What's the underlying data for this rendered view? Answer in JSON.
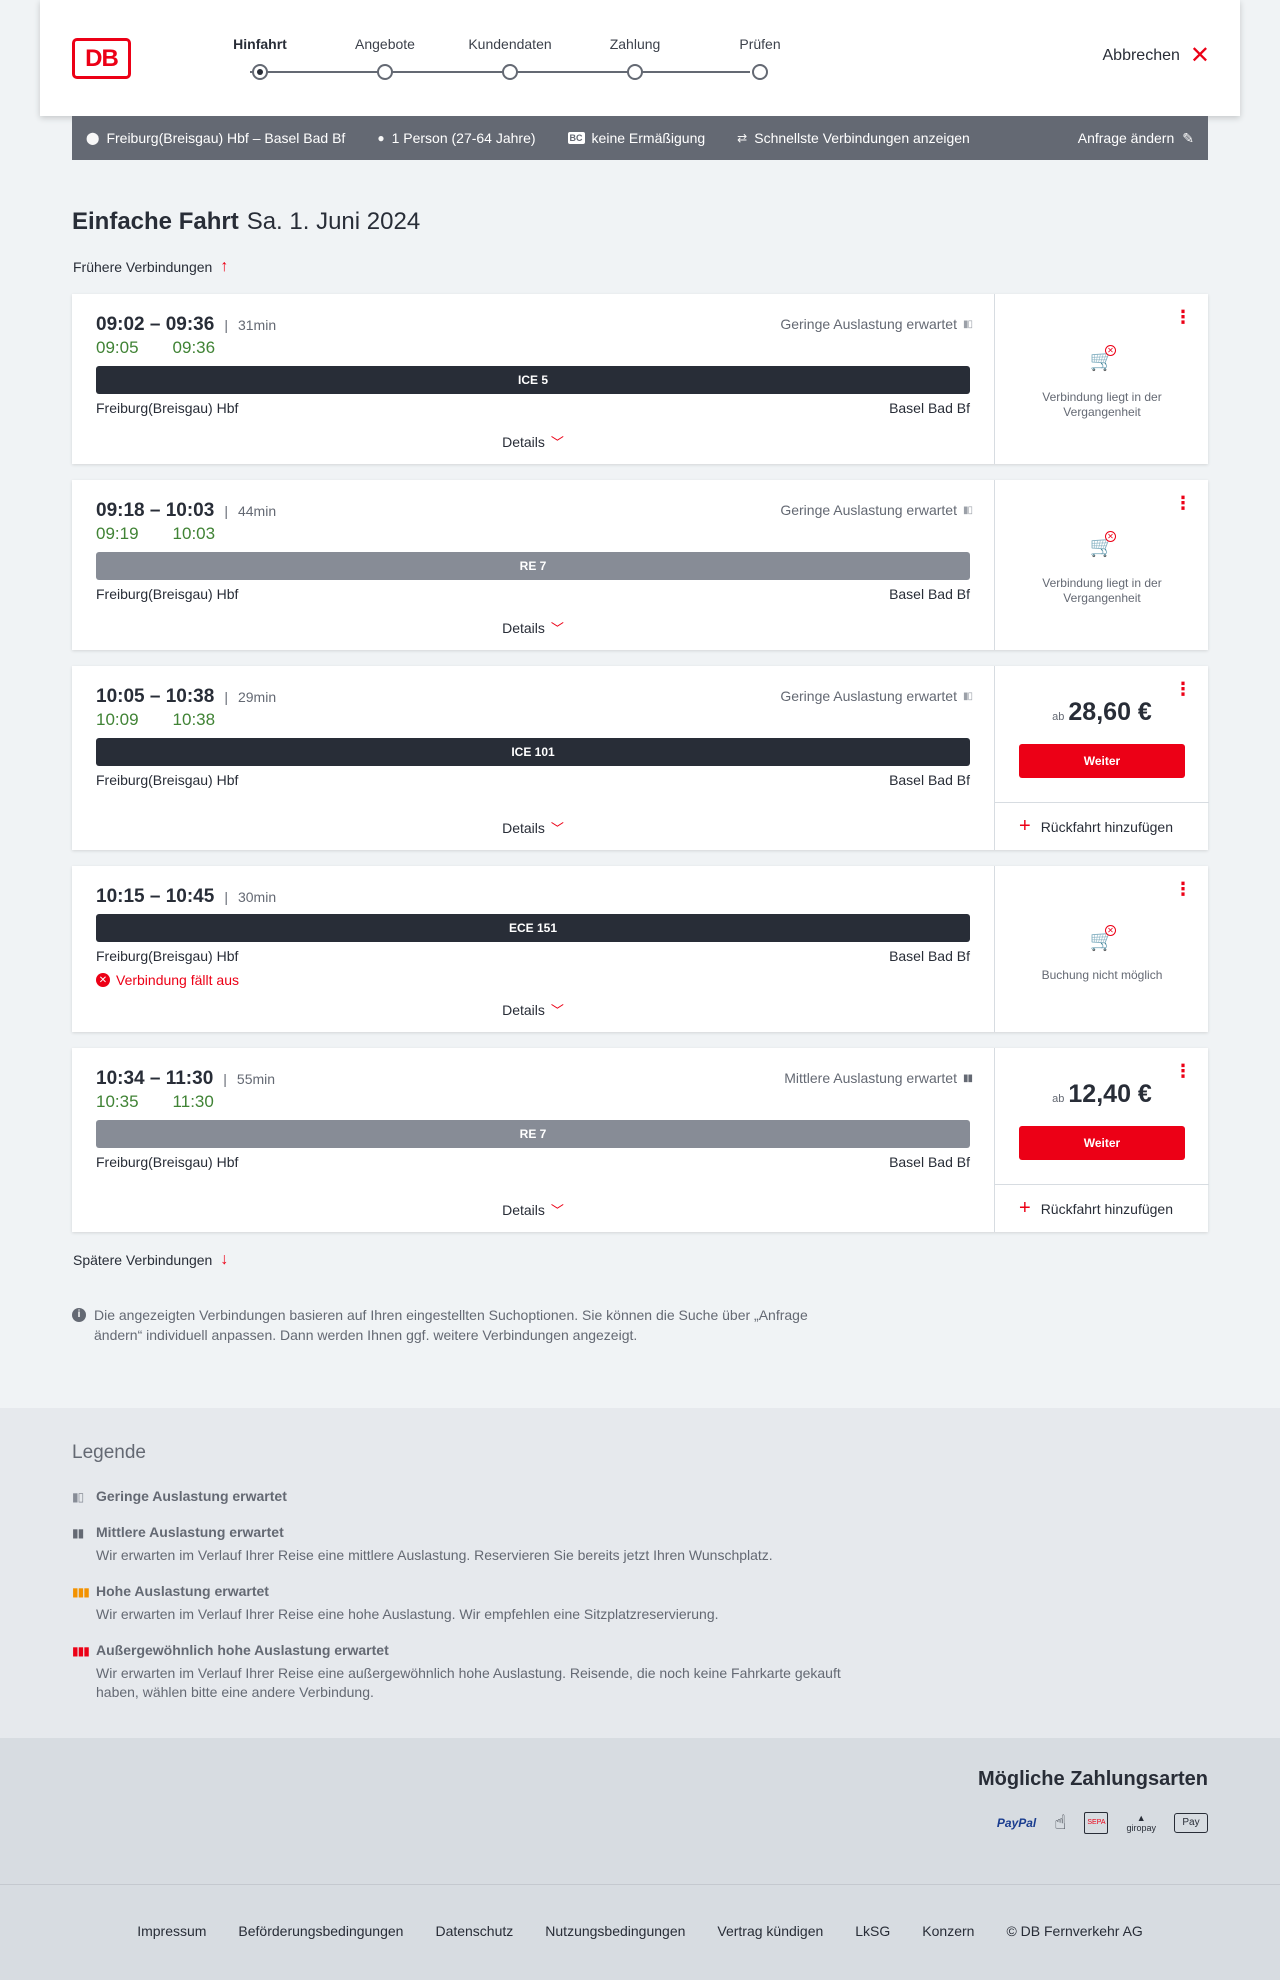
{
  "header": {
    "logo": "DB",
    "steps": [
      {
        "label": "Hinfahrt",
        "active": true
      },
      {
        "label": "Angebote",
        "active": false
      },
      {
        "label": "Kundendaten",
        "active": false
      },
      {
        "label": "Zahlung",
        "active": false
      },
      {
        "label": "Prüfen",
        "active": false
      }
    ],
    "cancel_label": "Abbrechen"
  },
  "search": {
    "route": "Freiburg(Breisgau) Hbf – Basel Bad Bf",
    "persons": "1 Person (27-64 Jahre)",
    "discount": "keine Ermäßigung",
    "discount_badge": "BC",
    "fastest": "Schnellste Verbindungen anzeigen",
    "edit": "Anfrage ändern"
  },
  "title": {
    "main": "Einfache Fahrt",
    "date": "Sa. 1. Juni 2024"
  },
  "earlier": "Frühere Verbindungen",
  "later": "Spätere Verbindungen",
  "common": {
    "details": "Details",
    "from": "Freiburg(Breisgau) Hbf",
    "to": "Basel Bad Bf",
    "weiter": "Weiter",
    "return": "Rückfahrt hinzufügen",
    "ab": "ab"
  },
  "connections": [
    {
      "times": "09:02 – 09:36",
      "duration": "31min",
      "rt_dep": "09:05",
      "rt_arr": "09:36",
      "load": "Geringe Auslastung erwartet",
      "train": "ICE 5",
      "status_text": "Verbindung liegt in der Vergangenheit"
    },
    {
      "times": "09:18 – 10:03",
      "duration": "44min",
      "rt_dep": "09:19",
      "rt_arr": "10:03",
      "load": "Geringe Auslastung erwartet",
      "train": "RE 7",
      "status_text": "Verbindung liegt in der Vergangenheit"
    },
    {
      "times": "10:05 – 10:38",
      "duration": "29min",
      "rt_dep": "10:09",
      "rt_arr": "10:38",
      "load": "Geringe Auslastung erwartet",
      "train": "ICE 101",
      "price": "28,60 €"
    },
    {
      "times": "10:15 – 10:45",
      "duration": "30min",
      "train": "ECE 151",
      "cancelled": "Verbindung fällt aus",
      "status_text": "Buchung nicht möglich"
    },
    {
      "times": "10:34 – 11:30",
      "duration": "55min",
      "rt_dep": "10:35",
      "rt_arr": "11:30",
      "load": "Mittlere Auslastung erwartet",
      "train": "RE 7",
      "price": "12,40 €"
    }
  ],
  "info": "Die angezeigten Verbindungen basieren auf Ihren eingestellten Suchoptionen. Sie können die Suche über „Anfrage ändern“ individuell anpassen. Dann werden Ihnen ggf. weitere Verbindungen angezeigt.",
  "legend": {
    "title": "Legende",
    "items": [
      {
        "heading": "Geringe Auslastung erwartet",
        "text": ""
      },
      {
        "heading": "Mittlere Auslastung erwartet",
        "text": "Wir erwarten im Verlauf Ihrer Reise eine mittlere Auslastung. Reservieren Sie bereits jetzt Ihren Wunschplatz."
      },
      {
        "heading": "Hohe Auslastung erwartet",
        "text": "Wir erwarten im Verlauf Ihrer Reise eine hohe Auslastung. Wir empfehlen eine Sitzplatzreservierung."
      },
      {
        "heading": "Außergewöhnlich hohe Auslastung erwartet",
        "text": "Wir erwarten im Verlauf Ihrer Reise eine außergewöhnlich hohe Auslastung. Reisende, die noch keine Fahrkarte gekauft haben, wählen bitte eine andere Verbindung."
      }
    ]
  },
  "payment": {
    "title": "Mögliche Zahlungsarten",
    "methods": [
      "PayPal",
      "SEPA",
      "giropay",
      "Pay"
    ]
  },
  "footer": [
    "Impressum",
    "Beförderungsbedingungen",
    "Datenschutz",
    "Nutzungsbedingungen",
    "Vertrag kündigen",
    "LkSG",
    "Konzern",
    "© DB Fernverkehr AG"
  ],
  "colors": {
    "brand_red": "#ec0016",
    "realtime_green": "#408335",
    "train_dark": "#282d37",
    "train_grey": "#878c96"
  }
}
